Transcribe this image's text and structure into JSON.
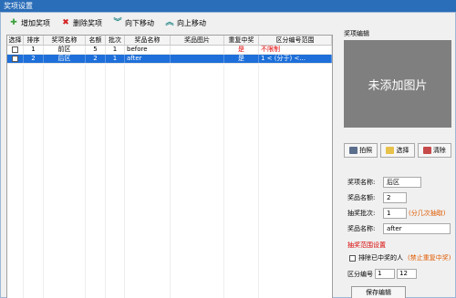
{
  "window": {
    "title": "奖项设置"
  },
  "toolbar": {
    "add_label": "增加奖项",
    "delete_label": "删除奖项",
    "move_down_label": "向下移动",
    "move_up_label": "向上移动"
  },
  "grid": {
    "columns": [
      "选择",
      "排序",
      "奖项名称",
      "名额",
      "批次",
      "奖品名称",
      "奖品图片",
      "重复中奖",
      "区分编号范围"
    ],
    "rows": [
      {
        "order": "1",
        "name": "前区",
        "quota": "5",
        "batch": "1",
        "prize": "before",
        "image": "",
        "repeat": "是",
        "range": "不限制",
        "selected": false
      },
      {
        "order": "2",
        "name": "后区",
        "quota": "2",
        "batch": "1",
        "prize": "after",
        "image": "",
        "repeat": "是",
        "range": "1 < (分于) <...",
        "selected": true
      }
    ]
  },
  "editor": {
    "panel_title": "奖项编辑",
    "image_placeholder": "未添加图片",
    "btn_shoot": "拍照",
    "btn_choose": "选择",
    "btn_clear": "清除",
    "name_label": "奖项名称:",
    "name_value": "后区",
    "quota_label": "奖品名额:",
    "quota_value": "2",
    "batch_label": "抽奖批次:",
    "batch_value": "1",
    "batch_hint": "(分几次抽取)",
    "prize_label": "奖品名称:",
    "prize_value": "after",
    "range_section": "抽奖范围设置",
    "exclude_label": "排除已中奖的人",
    "exclude_hint": "(禁止重复中奖)",
    "range_label": "区分编号",
    "range_from": "1",
    "range_to": "12",
    "save_label": "保存编辑"
  }
}
